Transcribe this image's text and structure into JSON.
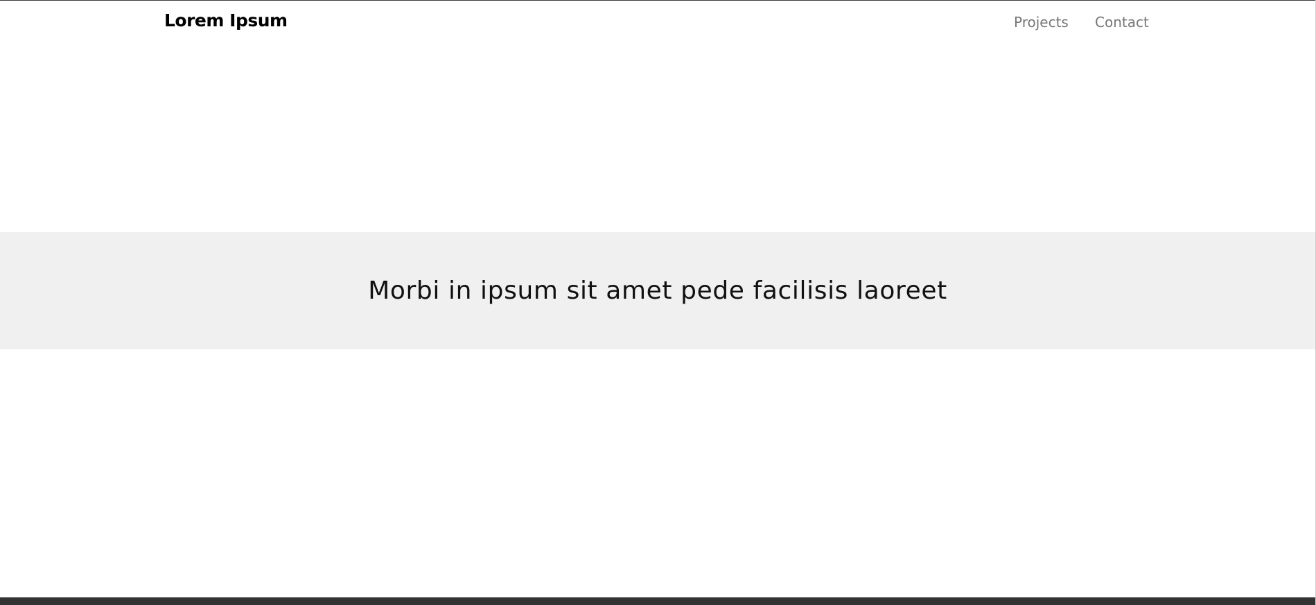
{
  "navbar": {
    "brand": "Lorem Ipsum",
    "links": [
      {
        "label": "Projects"
      },
      {
        "label": "Contact"
      }
    ]
  },
  "banner": {
    "heading": "Morbi in ipsum sit amet pede facilisis laoreet"
  },
  "colors": {
    "page_background": "#ffffff",
    "banner_background": "#f0f0f0",
    "brand_text": "#000000",
    "nav_link_text": "#777777",
    "footer_bar": "#333333"
  }
}
